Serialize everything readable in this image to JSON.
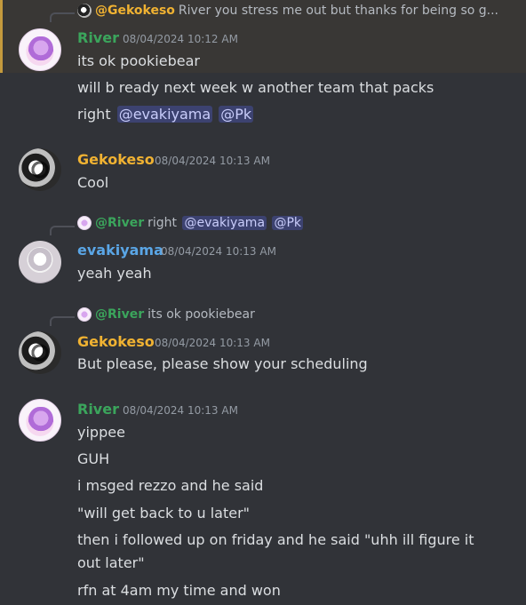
{
  "colors": {
    "background": "#313338",
    "highlight_background": "#393735",
    "highlight_border": "#c49a3d",
    "river": "#3ba55c",
    "gekokeso": "#f0b232",
    "evakiyama": "#5aa6e6",
    "mention_bg": "#3c4270",
    "mention_fg": "#c9cdfb",
    "timestamp": "#949ba4",
    "text": "#dbdee1"
  },
  "messages": [
    {
      "reply": {
        "author": "@Gekokeso",
        "text": "River you stress me out but thanks for being so g..."
      },
      "author": "River",
      "timestamp": "08/04/2024 10:12 AM",
      "lines": [
        "its ok pookiebear",
        "will b ready next week w another team that packs",
        "right"
      ],
      "mentions": [
        "@evakiyama",
        "@Pk"
      ]
    },
    {
      "author": "Gekokeso",
      "timestamp": "08/04/2024 10:13 AM",
      "lines": [
        "Cool"
      ]
    },
    {
      "reply": {
        "author": "@River",
        "text": "right",
        "mentions": [
          "@evakiyama",
          "@Pk"
        ]
      },
      "author": "evakiyama",
      "timestamp": "08/04/2024 10:13 AM",
      "lines": [
        "yeah yeah"
      ]
    },
    {
      "reply": {
        "author": "@River",
        "text": "its ok pookiebear"
      },
      "author": "Gekokeso",
      "timestamp": "08/04/2024 10:13 AM",
      "lines": [
        "But please, please show your scheduling"
      ]
    },
    {
      "author": "River",
      "timestamp": "08/04/2024 10:13 AM",
      "lines": [
        "yippee",
        "GUH",
        "i msged rezzo and he said",
        "\"will get back to u later\"",
        "then i followed up on friday and he said \"uhh ill figure it",
        "out later\"",
        "rfn at 4am my time and won"
      ]
    }
  ]
}
